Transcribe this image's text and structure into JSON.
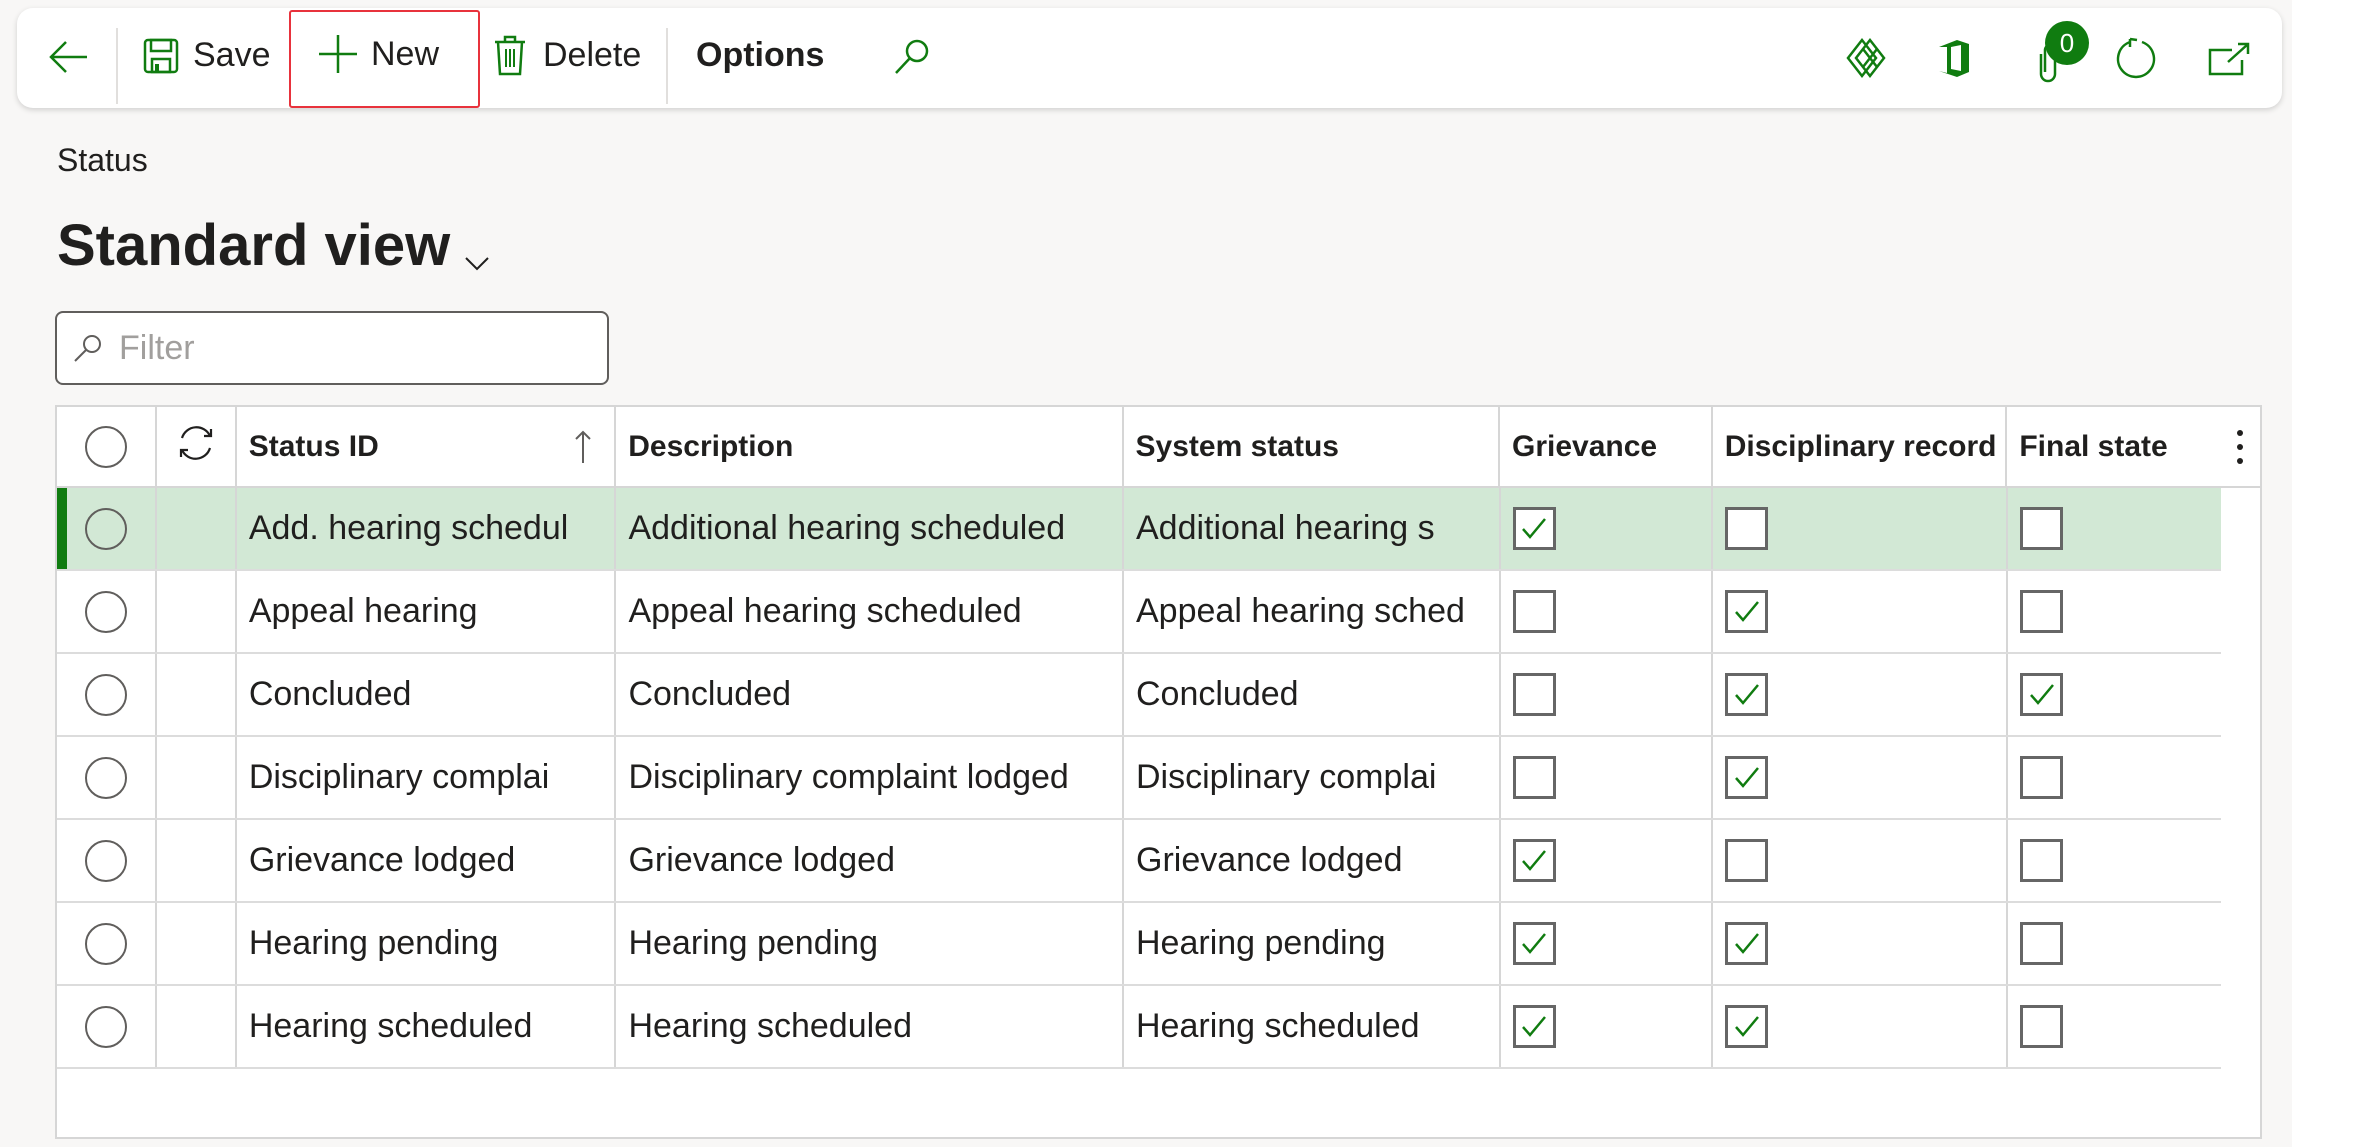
{
  "toolbar": {
    "back_label": "Back",
    "save_label": "Save",
    "new_label": "New",
    "delete_label": "Delete",
    "options_label": "Options",
    "attachments_count": "0",
    "icons": {
      "back": "arrow-left-icon",
      "save": "floppy-disk-icon",
      "new": "plus-icon",
      "delete": "trash-icon",
      "search": "search-icon",
      "power_apps": "diamond-grid-icon",
      "office": "office-icon",
      "attachments": "paperclip-icon",
      "refresh": "refresh-icon",
      "open_new_window": "open-in-new-window-icon"
    }
  },
  "header": {
    "breadcrumb": "Status",
    "view_name": "Standard view"
  },
  "filter": {
    "placeholder": "Filter",
    "value": ""
  },
  "grid": {
    "columns": [
      {
        "key": "status_id",
        "label": "Status ID",
        "sorted": "ascending"
      },
      {
        "key": "description",
        "label": "Description"
      },
      {
        "key": "system_status",
        "label": "System status"
      },
      {
        "key": "grievance",
        "label": "Grievance"
      },
      {
        "key": "disciplinary_record",
        "label": "Disciplinary record"
      },
      {
        "key": "final_state",
        "label": "Final state"
      }
    ],
    "rows": [
      {
        "status_id": "Add. hearing schedul",
        "description": "Additional hearing scheduled",
        "system_status": "Additional hearing s",
        "grievance": true,
        "disciplinary_record": false,
        "final_state": false,
        "selected": true
      },
      {
        "status_id": "Appeal hearing",
        "description": "Appeal hearing scheduled",
        "system_status": "Appeal hearing sched",
        "grievance": false,
        "disciplinary_record": true,
        "final_state": false,
        "selected": false
      },
      {
        "status_id": "Concluded",
        "description": "Concluded",
        "system_status": "Concluded",
        "grievance": false,
        "disciplinary_record": true,
        "final_state": true,
        "selected": false
      },
      {
        "status_id": "Disciplinary complai",
        "description": "Disciplinary complaint lodged",
        "system_status": "Disciplinary complai",
        "grievance": false,
        "disciplinary_record": true,
        "final_state": false,
        "selected": false
      },
      {
        "status_id": "Grievance lodged",
        "description": "Grievance lodged",
        "system_status": "Grievance lodged",
        "grievance": true,
        "disciplinary_record": false,
        "final_state": false,
        "selected": false
      },
      {
        "status_id": "Hearing pending",
        "description": "Hearing pending",
        "system_status": "Hearing pending",
        "grievance": true,
        "disciplinary_record": true,
        "final_state": false,
        "selected": false
      },
      {
        "status_id": "Hearing scheduled",
        "description": "Hearing scheduled",
        "system_status": "Hearing scheduled",
        "grievance": true,
        "disciplinary_record": true,
        "final_state": false,
        "selected": false
      }
    ]
  },
  "colors": {
    "accent": "#107c10",
    "selected_row": "#d2e8d5",
    "page_background": "#f8f7f6",
    "highlight_box": "#e8323c"
  }
}
